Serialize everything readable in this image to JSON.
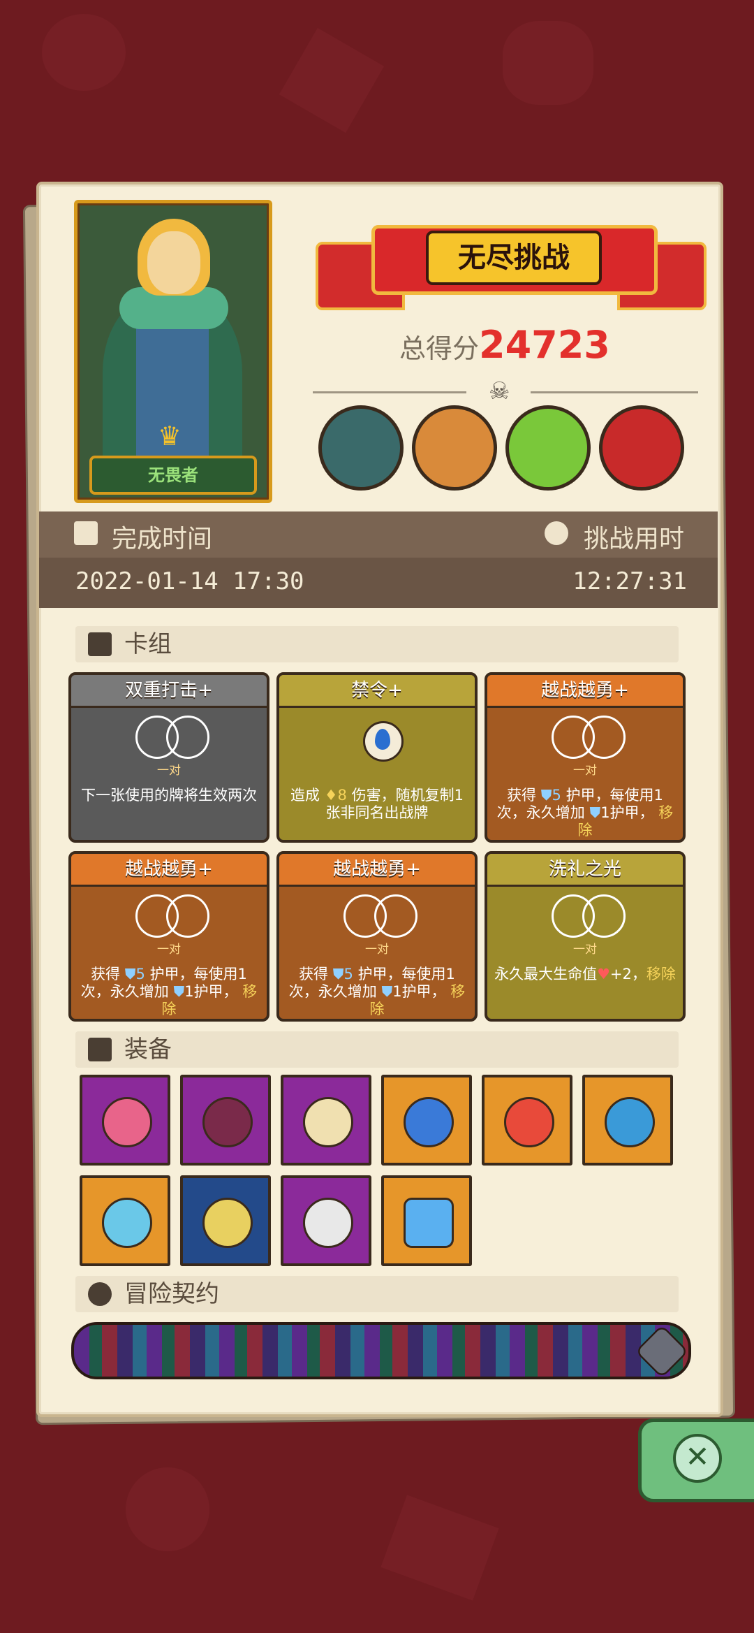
{
  "hero": {
    "title": "无畏者"
  },
  "mode": {
    "title": "无尽挑战"
  },
  "score": {
    "label": "总得分",
    "value": "24723"
  },
  "bosses": [
    {
      "name": "armored-knight"
    },
    {
      "name": "lion-warrior"
    },
    {
      "name": "green-demon"
    },
    {
      "name": "red-dragon"
    }
  ],
  "times": {
    "finish_label": "完成时间",
    "finish_value": "2022-01-14 17:30",
    "duration_label": "挑战用时",
    "duration_value": "12:27:31"
  },
  "sections": {
    "deck": "卡组",
    "equipment": "装备",
    "contract": "冒险契约"
  },
  "cards": [
    {
      "title": "双重打击+",
      "pair": "一对",
      "desc": "下一张使用的牌将生效两次",
      "color": "#5a5a5a"
    },
    {
      "title": "禁令+",
      "desc_pre": "造成",
      "damage": "8",
      "desc_post": "伤害，随机复制1张非同名出战牌",
      "color": "#9b8a2a"
    },
    {
      "title": "越战越勇+",
      "pair": "一对",
      "desc_a": "获得",
      "armor": "5",
      "desc_b": "护甲，每使用1次，永久增加",
      "armor2": "1",
      "desc_c": "护甲，",
      "remove": "移除",
      "color": "#a35a22"
    },
    {
      "title": "越战越勇+",
      "pair": "一对",
      "desc_a": "获得",
      "armor": "5",
      "desc_b": "护甲，每使用1次，永久增加",
      "armor2": "1",
      "desc_c": "护甲，",
      "remove": "移除",
      "color": "#a35a22"
    },
    {
      "title": "越战越勇+",
      "pair": "一对",
      "desc_a": "获得",
      "armor": "5",
      "desc_b": "护甲，每使用1次，永久增加",
      "armor2": "1",
      "desc_c": "护甲，",
      "remove": "移除",
      "color": "#a35a22"
    },
    {
      "title": "洗礼之光",
      "pair": "一对",
      "desc_a": "永久最大生命值",
      "hp": "+2",
      "desc_b": "，",
      "remove": "移除",
      "color": "#9b8a2a"
    }
  ],
  "equipment": [
    {
      "name": "mushroom-cap-icon",
      "bg": "#8b2a9a",
      "color": "#e8648a"
    },
    {
      "name": "armor-vest-icon",
      "bg": "#8b2a9a",
      "color": "#7a2a4a"
    },
    {
      "name": "fangs-icon",
      "bg": "#8b2a9a",
      "color": "#f0e0b0"
    },
    {
      "name": "blue-ring-icon",
      "bg": "#e6962a",
      "color": "#3a7ad8"
    },
    {
      "name": "shield-disc-icon",
      "bg": "#e6962a",
      "color": "#e84a3a"
    },
    {
      "name": "spiked-armor-icon",
      "bg": "#e6962a",
      "color": "#3a9ad8"
    },
    {
      "name": "ice-shield-icon",
      "bg": "#e6962a",
      "color": "#6ac8e8"
    },
    {
      "name": "compass-plate-icon",
      "bg": "#234a8a",
      "color": "#e8d060"
    },
    {
      "name": "mirror-icon",
      "bg": "#8b2a9a",
      "color": "#e8e8e8"
    },
    {
      "name": "ice-cube-icon",
      "bg": "#e6962a",
      "color": "#5ab0f0"
    }
  ]
}
